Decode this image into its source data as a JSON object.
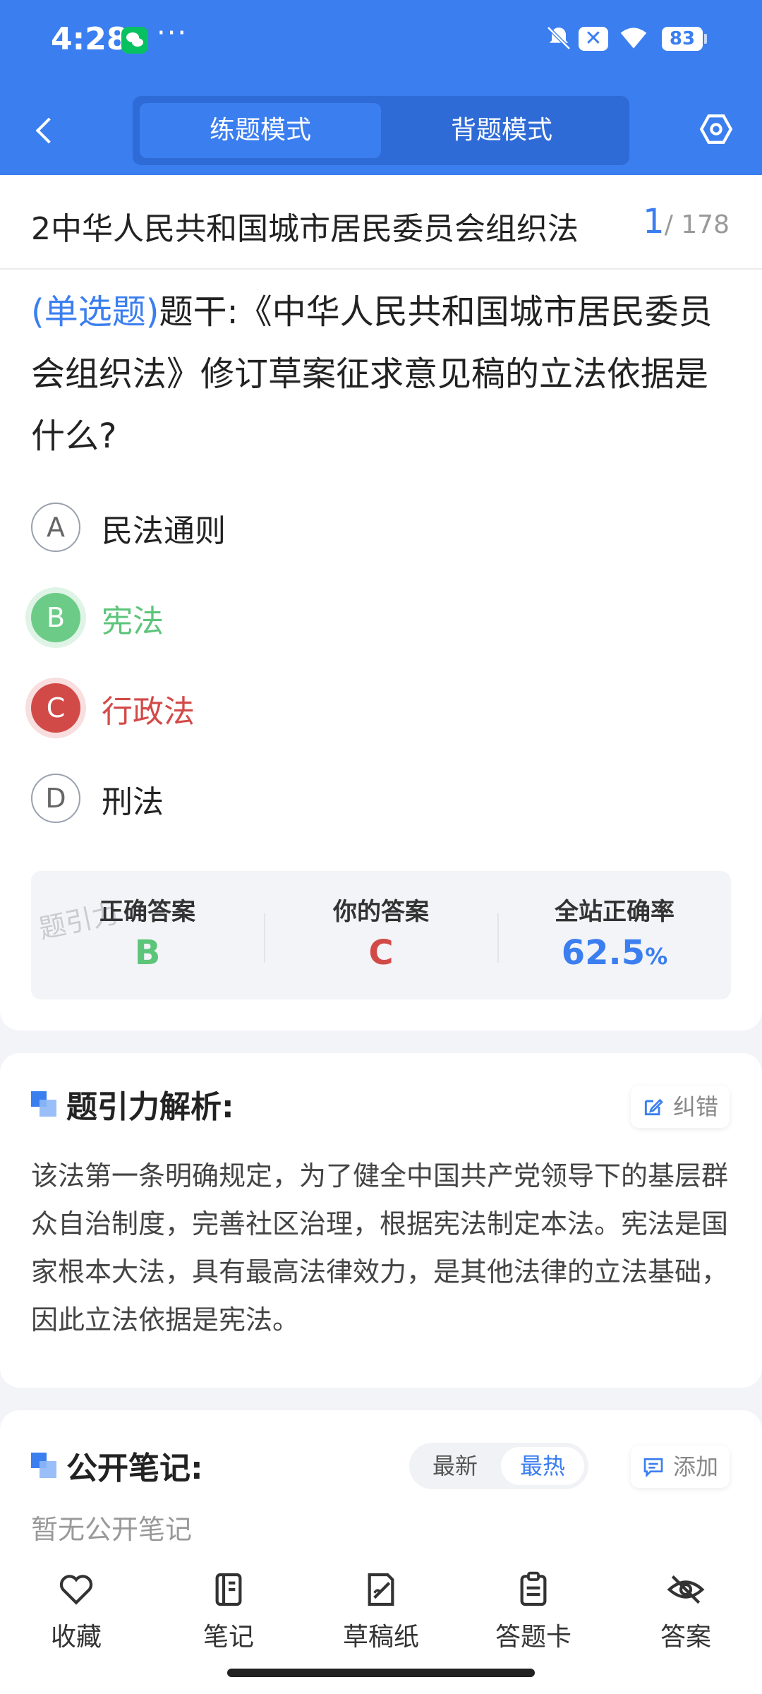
{
  "status_bar": {
    "time": "4:28",
    "more": "···",
    "battery": "83"
  },
  "header": {
    "modes": [
      "练题模式",
      "背题模式"
    ],
    "active_mode": "练题模式"
  },
  "topic": {
    "title": "2中华人民共和国城市居民委员会组织法",
    "current": "1",
    "total": "/ 178"
  },
  "question": {
    "type": "(单选题)",
    "text": "题干:《中华人民共和国城市居民委员会组织法》修订草案征求意见稿的立法依据是什么?"
  },
  "options": [
    {
      "letter": "A",
      "text": "民法通则",
      "state": "normal"
    },
    {
      "letter": "B",
      "text": "宪法",
      "state": "correct"
    },
    {
      "letter": "C",
      "text": "行政法",
      "state": "wrong"
    },
    {
      "letter": "D",
      "text": "刑法",
      "state": "normal"
    }
  ],
  "stats": {
    "correct_label": "正确答案",
    "correct_value": "B",
    "yours_label": "你的答案",
    "yours_value": "C",
    "rate_label": "全站正确率",
    "rate_value": "62.5",
    "rate_unit": "%",
    "watermark": "题引力"
  },
  "analysis": {
    "title": "题引力解析:",
    "report_label": "纠错",
    "text": "该法第一条明确规定，为了健全中国共产党领导下的基层群众自治制度，完善社区治理，根据宪法制定本法。宪法是国家根本大法，具有最高法律效力，是其他法律的立法基础，因此立法依据是宪法。"
  },
  "notes": {
    "title": "公开笔记:",
    "sort_latest": "最新",
    "sort_hot": "最热",
    "add_label": "添加",
    "empty_text": "暂无公开笔记"
  },
  "bottom_nav": [
    {
      "label": "收藏",
      "icon": "heart-icon"
    },
    {
      "label": "笔记",
      "icon": "notebook-icon"
    },
    {
      "label": "草稿纸",
      "icon": "draft-icon"
    },
    {
      "label": "答题卡",
      "icon": "answer-card-icon"
    },
    {
      "label": "答案",
      "icon": "eye-off-icon"
    }
  ],
  "colors": {
    "primary": "#3b7ef0",
    "correct": "#5cc57a",
    "wrong": "#d24a48"
  }
}
